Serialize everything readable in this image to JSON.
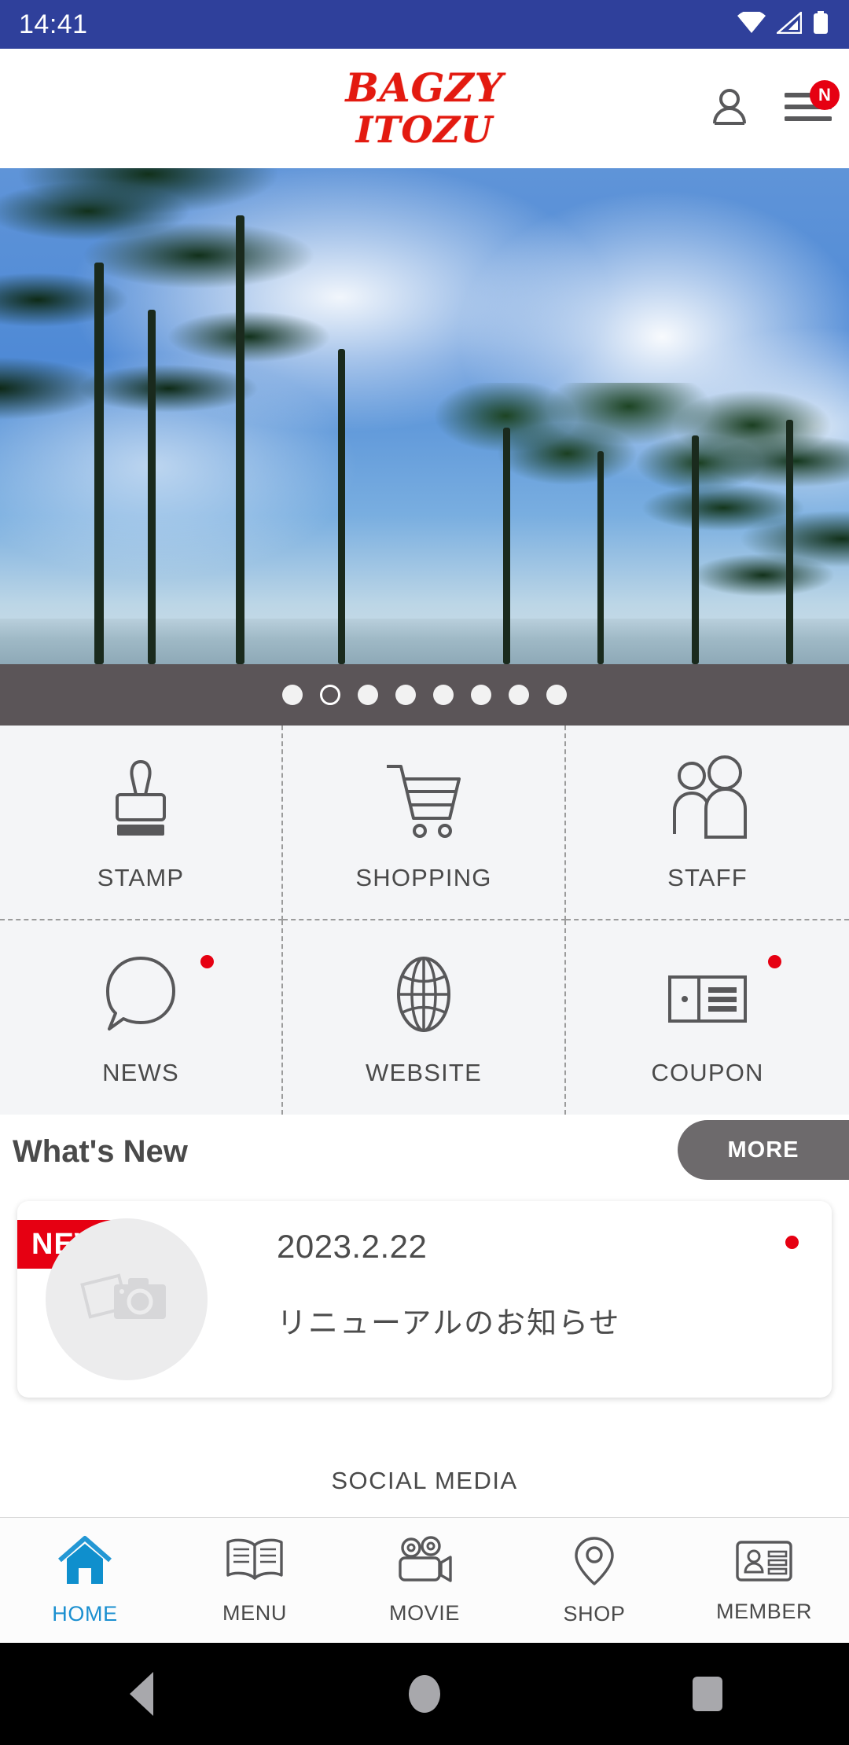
{
  "status_bar": {
    "time": "14:41",
    "icons": [
      "wifi-icon",
      "cellular-signal-icon",
      "battery-full-icon"
    ],
    "background_color": "#2f409b"
  },
  "header": {
    "logo_line1": "BAGZY",
    "logo_line2": "ITOZU",
    "logo_color": "#e31a10",
    "account_icon": "person-icon",
    "menu_icon": "hamburger-menu-icon",
    "menu_badge": "N",
    "menu_badge_color": "#e60012"
  },
  "hero": {
    "alt": "tropical palm trees beach",
    "dot_count": 8,
    "active_dot_index": 1,
    "bar_color": "#5b5558"
  },
  "grid": {
    "items": [
      {
        "label": "STAMP",
        "icon": "stamp-icon",
        "badge": false
      },
      {
        "label": "SHOPPING",
        "icon": "shopping-cart-icon",
        "badge": false
      },
      {
        "label": "STAFF",
        "icon": "staff-people-icon",
        "badge": false
      },
      {
        "label": "NEWS",
        "icon": "speech-bubble-icon",
        "badge": true
      },
      {
        "label": "WEBSITE",
        "icon": "globe-icon",
        "badge": false
      },
      {
        "label": "COUPON",
        "icon": "coupon-ticket-icon",
        "badge": true
      }
    ],
    "badge_color": "#e60012"
  },
  "whats_new": {
    "title": "What's New",
    "more_label": "MORE",
    "more_color": "#6d6a6c",
    "card": {
      "ribbon": "NEW",
      "ribbon_color": "#e60012",
      "date": "2023.2.22",
      "text": "リニューアルのお知らせ",
      "thumbnail_icon": "photo-camera-placeholder-icon",
      "unread_badge": true
    }
  },
  "social": {
    "heading": "SOCIAL MEDIA"
  },
  "tabbar": {
    "active_color": "#1a8fd0",
    "items": [
      {
        "label": "HOME",
        "icon": "home-icon",
        "active": true
      },
      {
        "label": "MENU",
        "icon": "open-book-icon",
        "active": false
      },
      {
        "label": "MOVIE",
        "icon": "movie-camera-icon",
        "active": false
      },
      {
        "label": "SHOP",
        "icon": "map-pin-icon",
        "active": false
      },
      {
        "label": "MEMBER",
        "icon": "id-card-icon",
        "active": false
      }
    ]
  },
  "android_nav": {
    "back": "back-triangle-icon",
    "home": "home-circle-icon",
    "recents": "recents-square-icon"
  }
}
